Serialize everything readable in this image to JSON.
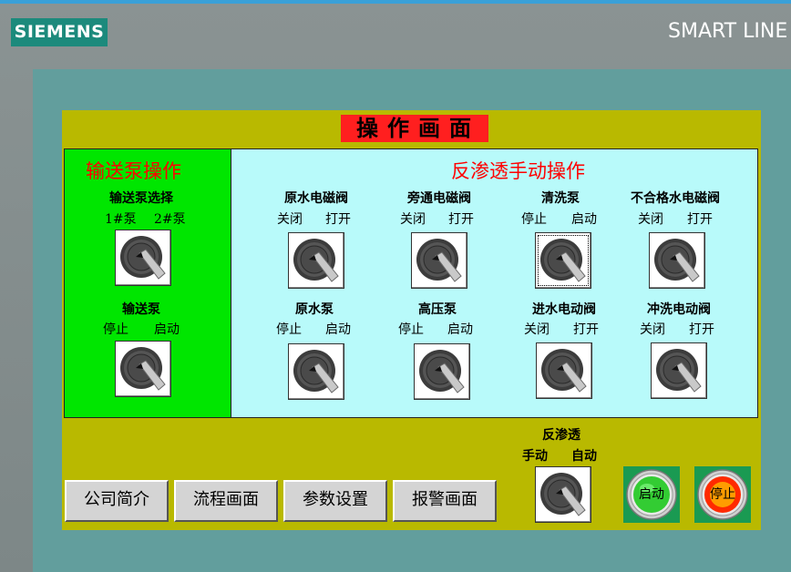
{
  "brand": "SIEMENS",
  "model": "SMART LINE",
  "title": "操作画面",
  "left_section": {
    "title": "输送泵操作",
    "switches": [
      {
        "name": "输送泵选择",
        "left": "1#泵",
        "right": "2#泵"
      },
      {
        "name": "输送泵",
        "left": "停止",
        "right": "启动"
      }
    ]
  },
  "right_section": {
    "title": "反渗透手动操作",
    "switches": [
      {
        "name": "原水电磁阀",
        "left": "关闭",
        "right": "打开"
      },
      {
        "name": "旁通电磁阀",
        "left": "关闭",
        "right": "打开"
      },
      {
        "name": "清洗泵",
        "left": "停止",
        "right": "启动"
      },
      {
        "name": "不合格水电磁阀",
        "left": "关闭",
        "right": "打开"
      },
      {
        "name": "原水泵",
        "left": "停止",
        "right": "启动"
      },
      {
        "name": "高压泵",
        "left": "停止",
        "right": "启动"
      },
      {
        "name": "进水电动阀",
        "left": "关闭",
        "right": "打开"
      },
      {
        "name": "冲洗电动阀",
        "left": "关闭",
        "right": "打开"
      }
    ]
  },
  "bottom": {
    "nav_buttons": [
      "公司简介",
      "流程画面",
      "参数设置",
      "报警画面"
    ],
    "ro_switch": {
      "name": "反渗透",
      "left": "手动",
      "right": "自动"
    },
    "start_label": "启动",
    "stop_label": "停止"
  },
  "colors": {
    "panel": "#b9b900",
    "left_bg": "#00e600",
    "right_bg": "#b8fafa",
    "title_bg": "#ff1f1f",
    "start_lamp": "#33cc33",
    "stop_lamp": "#ff2a00"
  }
}
